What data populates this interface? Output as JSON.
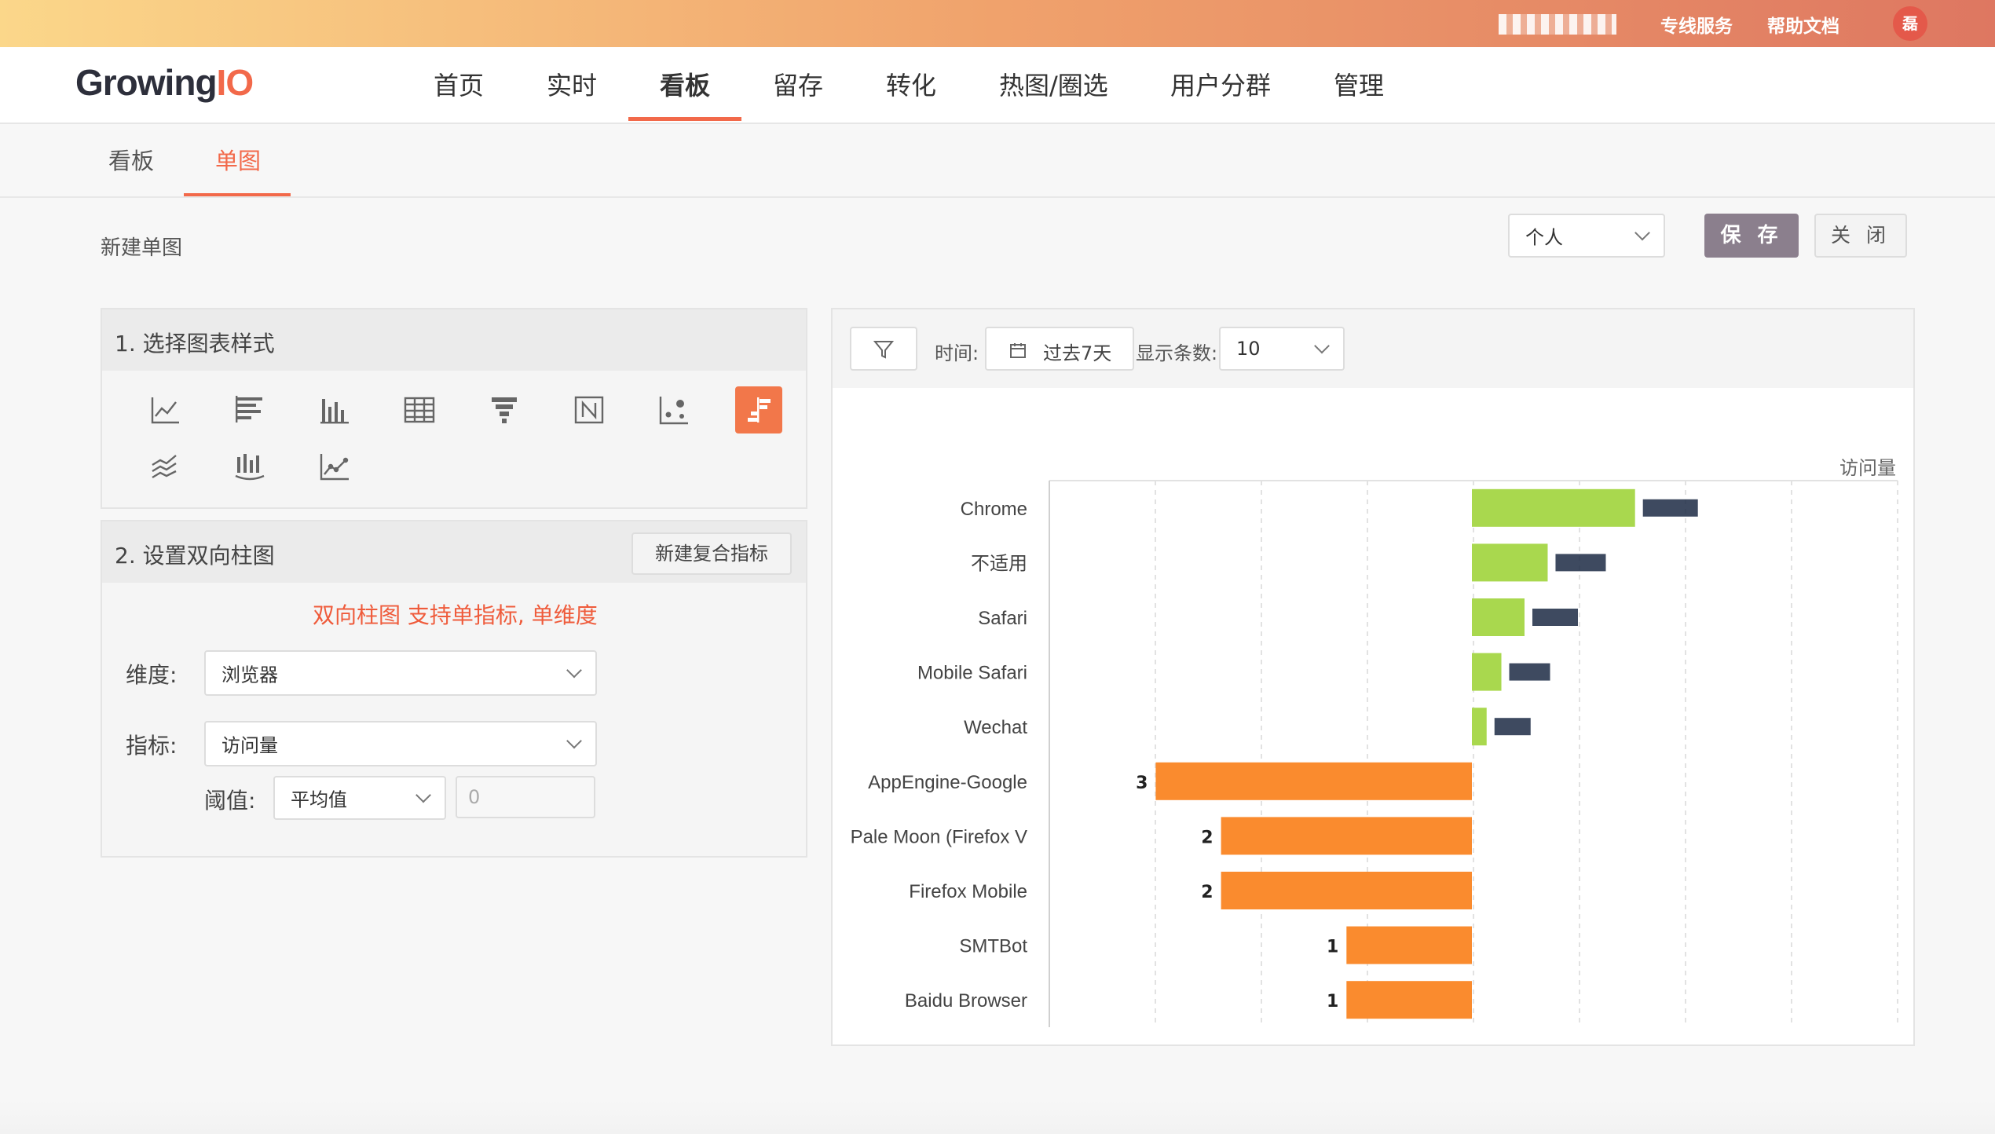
{
  "topbar": {
    "links": [
      "专线服务",
      "帮助文档"
    ],
    "avatar": "磊"
  },
  "brand": {
    "logo_main": "Growing",
    "logo_accent": "IO"
  },
  "nav": {
    "items": [
      "首页",
      "实时",
      "看板",
      "留存",
      "转化",
      "热图/圈选",
      "用户分群",
      "管理"
    ],
    "active_index": 2
  },
  "subnav": {
    "items": [
      "看板",
      "单图"
    ],
    "active_index": 1
  },
  "page": {
    "title": "新建单图"
  },
  "controls": {
    "scope_value": "个人",
    "save_label": "保 存",
    "close_label": "关 闭"
  },
  "panel1": {
    "title": "1. 选择图表样式",
    "icons": [
      "line-chart-icon",
      "horizontal-bar-icon",
      "vertical-bar-icon",
      "table-icon",
      "funnel-icon",
      "number-icon",
      "scatter-icon",
      "bidirectional-bar-icon",
      "stacked-area-icon",
      "stacked-bar-icon",
      "trend-line-icon"
    ],
    "active_icon": "bidirectional-bar-icon"
  },
  "panel2": {
    "title": "2. 设置双向柱图",
    "compose_button": "新建复合指标",
    "hint": "双向柱图 支持单指标, 单维度",
    "dimension_label": "维度:",
    "dimension_value": "浏览器",
    "metric_label": "指标:",
    "metric_value": "访问量",
    "threshold_label": "阈值:",
    "threshold_mode": "平均值",
    "threshold_value": "0"
  },
  "chart_panel": {
    "time_label": "时间:",
    "time_value": "过去7天",
    "count_label": "显示条数:",
    "count_value": "10"
  },
  "chart_data": {
    "type": "bar",
    "orientation": "horizontal-diverging",
    "ylabel": "访问量",
    "categories": [
      "Chrome",
      "不适用",
      "Safari",
      "Mobile Safari",
      "Wechat",
      "AppEngine-Google",
      "Pale Moon (Firefox V",
      "Firefox Mobile",
      "SMTBot",
      "Baidu Browser"
    ],
    "above_threshold": {
      "color": "#a9d84e",
      "values": [
        1.55,
        0.72,
        0.5,
        0.28,
        0.14,
        null,
        null,
        null,
        null,
        null
      ],
      "labels": [
        "",
        "",
        "",
        "",
        "",
        null,
        null,
        null,
        null,
        null
      ]
    },
    "below_threshold": {
      "color": "#fa8b2e",
      "values": [
        null,
        null,
        null,
        null,
        null,
        3,
        2,
        2,
        1,
        1
      ],
      "labels": [
        null,
        null,
        null,
        null,
        null,
        "3",
        "2",
        "2",
        "1",
        "1"
      ]
    },
    "grid": true
  }
}
